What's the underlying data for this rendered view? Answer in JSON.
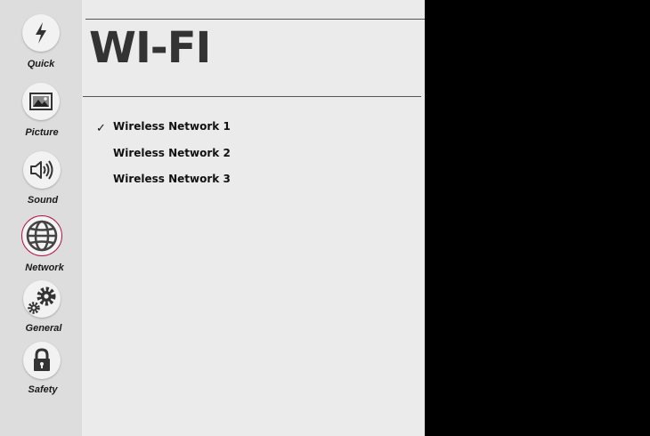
{
  "sidebar": {
    "items": [
      {
        "label": "Quick",
        "icon": "lightning-icon",
        "active": false
      },
      {
        "label": "Picture",
        "icon": "picture-icon",
        "active": false
      },
      {
        "label": "Sound",
        "icon": "speaker-icon",
        "active": false
      },
      {
        "label": "Network",
        "icon": "globe-icon",
        "active": true
      },
      {
        "label": "General",
        "icon": "gears-icon",
        "active": false
      },
      {
        "label": "Safety",
        "icon": "lock-icon",
        "active": false
      }
    ]
  },
  "main": {
    "title": "WI-FI",
    "networks": [
      {
        "name": "Wireless Network 1",
        "selected": true
      },
      {
        "name": "Wireless Network 2",
        "selected": false
      },
      {
        "name": "Wireless Network 3",
        "selected": false
      }
    ],
    "check_mark": "✓"
  },
  "colors": {
    "sidebar_bg": "#dddddd",
    "panel_bg": "#ebebeb",
    "active_ring": "#b0164e",
    "background": "#000000"
  }
}
